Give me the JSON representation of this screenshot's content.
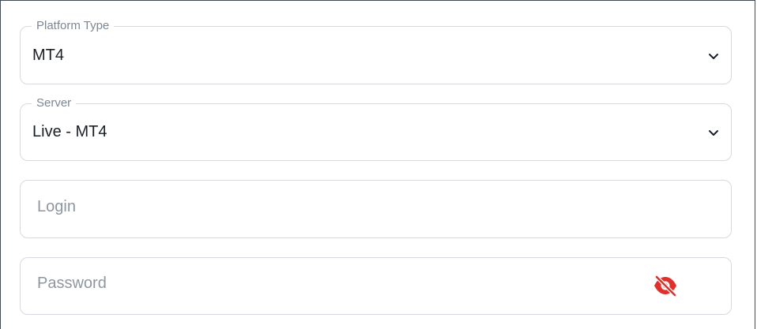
{
  "platform_type": {
    "label": "Platform Type",
    "value": "MT4",
    "icon": "chevron-down-icon"
  },
  "server": {
    "label": "Server",
    "value": "Live - MT4",
    "icon": "chevron-down-icon"
  },
  "login": {
    "placeholder": "Login"
  },
  "password": {
    "placeholder": "Password",
    "icon": "eye-slash-icon",
    "icon_color": "#e0302b"
  }
}
